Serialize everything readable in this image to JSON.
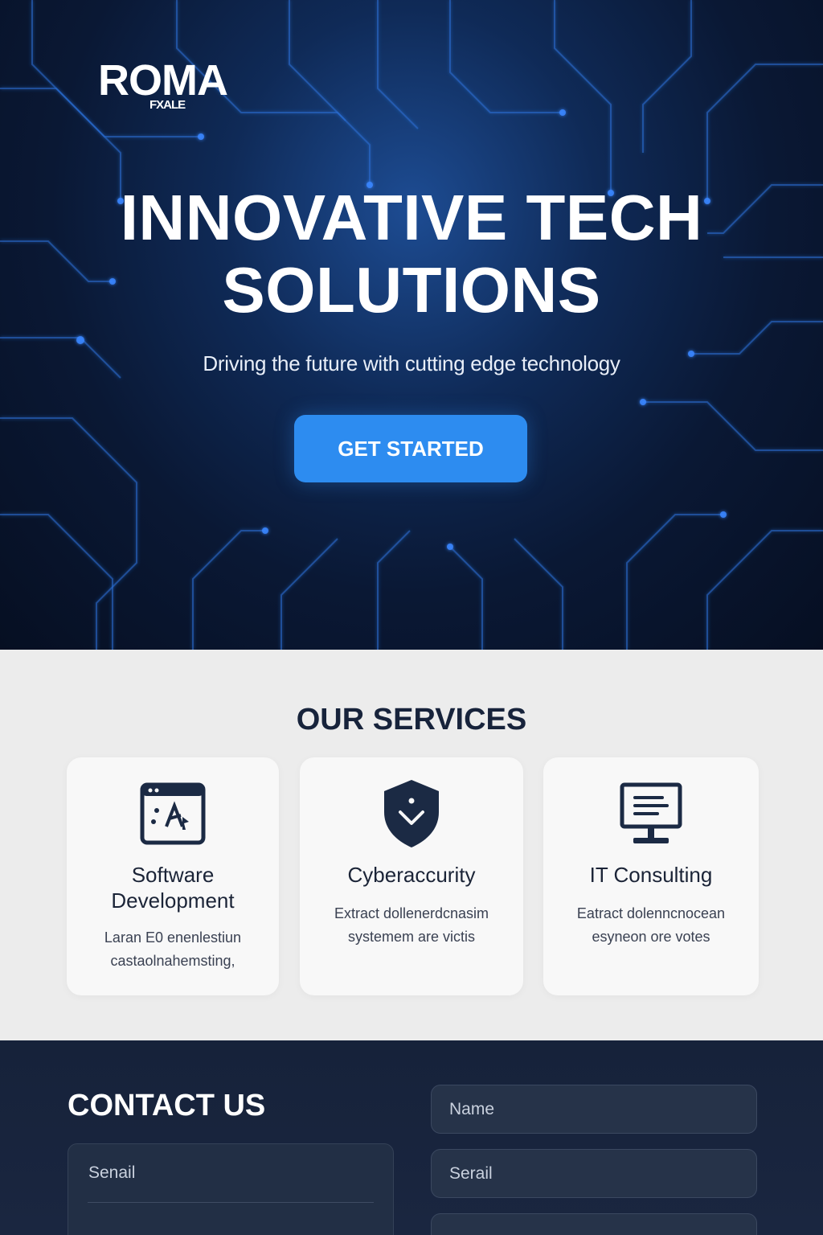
{
  "brand": {
    "name": "ROMA",
    "tagline": "FXALE"
  },
  "hero": {
    "title_line1": "INNOVATIVE TECH",
    "title_line2": "SOLUTIONS",
    "subtitle": "Driving the future with cutting edge technology",
    "cta_label": "GET STARTED"
  },
  "services": {
    "title": "OUR SERVICES",
    "items": [
      {
        "icon": "code-window-icon",
        "title_line1": "Software",
        "title_line2": "Development",
        "desc_line1": "Laran E0 enenlestiun",
        "desc_line2": "castaolnahemsting,"
      },
      {
        "icon": "shield-icon",
        "title_line1": "Cyberaccurity",
        "desc_line1": "Extract dollenerdcnasim",
        "desc_line2": "systemem are victis"
      },
      {
        "icon": "monitor-icon",
        "title_line1": "IT Consulting",
        "desc_line1": "Eatract dolenncnocean",
        "desc_line2": "esyneon ore votes"
      }
    ]
  },
  "contact": {
    "title": "CONTACT US",
    "name_placeholder": "Name",
    "email_placeholder": "Serail",
    "message_label": "Senail"
  },
  "colors": {
    "hero_bg": "#0a1834",
    "accent": "#2d8cf0",
    "services_bg": "#ececec",
    "contact_bg": "#16223a",
    "dark_text": "#1b2437"
  }
}
